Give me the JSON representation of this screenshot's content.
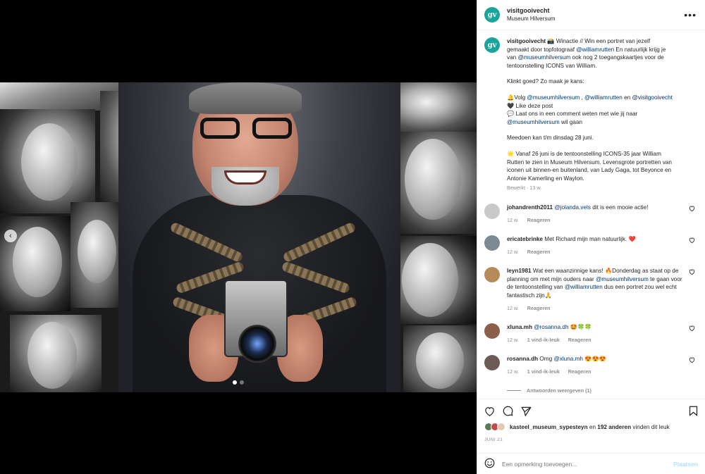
{
  "header": {
    "username": "visitgooivecht",
    "location": "Museum Hilversum",
    "avatar_text": "gv",
    "more_icon": "more-horizontal-icon"
  },
  "caption": {
    "username": "visitgooivecht",
    "lines": [
      [
        "📸 Winactie // Win een portret van jezelf"
      ],
      [
        "gemaakt door topfotograaf ",
        "@williamrutten",
        " En natuurlijk krijg je"
      ],
      [
        "van ",
        "@museumhilversum",
        " ook nog 2 toegangskaartjes voor de"
      ],
      [
        "tentoonstelling ICONS van William."
      ],
      [
        ""
      ],
      [
        "Klinkt goed? Zo maak je kans:"
      ],
      [
        ""
      ],
      [
        "🔔Volg ",
        "@museumhilversum",
        " , ",
        "@williamrutten",
        " en ",
        "@visitgooivecht"
      ],
      [
        "🖤 Like deze post"
      ],
      [
        "💬 Laat ons in een comment weten met wie jij naar"
      ],
      [
        "@museumhilversum",
        " wil gaan"
      ],
      [
        ""
      ],
      [
        "Meedoen kan t/m dinsdag 28 juni."
      ],
      [
        ""
      ],
      [
        "🌟 Vanaf 26 juni is de tentoonstelling ICONS-35 jaar William"
      ],
      [
        "Rutten te zien in Museum Hilversum. Levensgrote portretten van"
      ],
      [
        "iconen uit binnen-en buitenland, van Lady Gaga, tot Beyonce en"
      ],
      [
        "Antonie Kamerling en Waylon."
      ]
    ],
    "meta": "Bewerkt · 13 w."
  },
  "comments": [
    {
      "username": "johandrenth2011",
      "text_parts": [
        "@jolanda.vels",
        " dit is een mooie actie!"
      ],
      "age": "12 w.",
      "likes": "",
      "reply": "Reageren",
      "avatar_color": "#c9c9c9"
    },
    {
      "username": "ericatebrinke",
      "text_parts": [
        "Met Richard mijn man natuurlijk. ❤️"
      ],
      "age": "12 w.",
      "likes": "",
      "reply": "Reageren",
      "avatar_color": "#7d8a93"
    },
    {
      "username": "leyn1981",
      "text_parts": [
        "Wat een waanzinnige kans! 🔥Donderdag as staat op de planning om met mijn ouders naar ",
        "@museumhilversum",
        " te gaan voor de tentoonstelling van ",
        "@williamrutten",
        " dus een portret zou wel echt fantastisch zijn🙏"
      ],
      "age": "12 w.",
      "likes": "",
      "reply": "Reageren",
      "avatar_color": "#b78a5a"
    },
    {
      "username": "xluna.mh",
      "text_parts": [
        "@rosanna.dh",
        " 🤩🍀🍀"
      ],
      "age": "12 w.",
      "likes": "1 vind-ik-leuk",
      "reply": "Reageren",
      "avatar_color": "#8c5f4a"
    },
    {
      "username": "rosanna.dh",
      "text_parts": [
        "Omg ",
        "@xluna.mh",
        " 😍😍😍"
      ],
      "age": "12 w.",
      "likes": "1 vind-ik-leuk",
      "reply": "Reageren",
      "avatar_color": "#6b5a55"
    }
  ],
  "view_replies": "Antwoorden weergeven (1)",
  "actions": {
    "like_icon": "heart-icon",
    "comment_icon": "comment-icon",
    "share_icon": "send-icon",
    "save_icon": "bookmark-icon"
  },
  "likes": {
    "user": "kasteel_museum_sypesteyn",
    "middle": " en ",
    "others": "192 anderen",
    "suffix": " vinden dit leuk"
  },
  "date": "JUNI 21",
  "add_comment": {
    "placeholder": "Een opmerking toevoegen...",
    "post_label": "Plaatsen",
    "emoji_icon": "smiley-icon"
  },
  "carousel": {
    "prev_label": "‹",
    "slide_count": 2,
    "active_slide": 1
  }
}
